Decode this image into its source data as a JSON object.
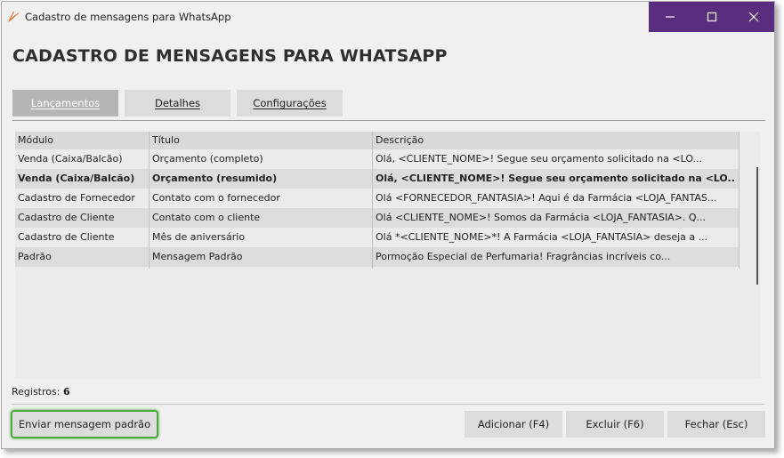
{
  "window": {
    "title": "Cadastro de mensagens para WhatsApp",
    "controls": {
      "minimize": "—",
      "maximize": "☐",
      "close": "✕"
    }
  },
  "heading": "CADASTRO DE MENSAGENS PARA WHATSAPP",
  "tabs": [
    {
      "label": "Lançamentos",
      "active": true
    },
    {
      "label": "Detalhes",
      "active": false
    },
    {
      "label": "Configurações",
      "active": false
    }
  ],
  "grid": {
    "columns": [
      "Módulo",
      "Título",
      "Descrição"
    ],
    "rows": [
      [
        "Venda (Caixa/Balcão)",
        "Orçamento (completo)",
        "Olá, <CLIENTE_NOME>!  Segue seu orçamento solicitado na <LO..."
      ],
      [
        "Venda (Caixa/Balcão)",
        "Orçamento (resumido)",
        "Olá, <CLIENTE_NOME>!  Segue seu orçamento solicitado na <LO..."
      ],
      [
        "Cadastro de Fornecedor",
        "Contato com o fornecedor",
        "Olá <FORNECEDOR_FANTASIA>!  Aqui é da Farmácia <LOJA_FANTAS..."
      ],
      [
        "Cadastro de Cliente",
        "Contato com o cliente",
        "Olá <CLIENTE_NOME>!  Somos da Farmácia <LOJA_FANTASIA>.  Q..."
      ],
      [
        "Cadastro de Cliente",
        "Mês de aniversário",
        "Olá *<CLIENTE_NOME>*!  A Farmácia <LOJA_FANTASIA> deseja a ..."
      ],
      [
        "Padrão",
        "Mensagem Padrão",
        "Pormoção Especial de Perfumaria!  Fragrâncias incríveis co..."
      ]
    ],
    "selected_row": 1
  },
  "footer": {
    "records_label": "Registros:",
    "records_count": "6"
  },
  "buttons": {
    "send_default": "Enviar mensagem padrão",
    "add": "Adicionar (F4)",
    "delete": "Excluir (F6)",
    "close": "Fechar (Esc)"
  },
  "colors": {
    "titlebar_controls": "#5b2d7e",
    "default_button_border": "#4caa3c",
    "app_icon": "#e8601c"
  }
}
